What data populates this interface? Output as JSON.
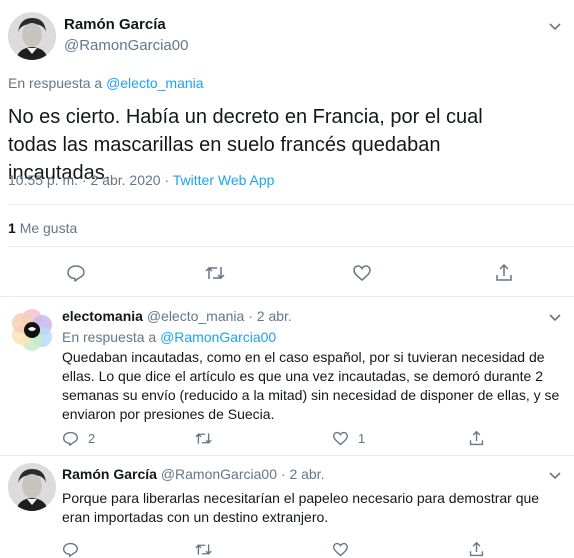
{
  "main_tweet": {
    "author_name": "Ramón García",
    "author_handle": "@RamonGarcia00",
    "reply_prefix": "En respuesta a",
    "reply_to": "@electo_mania",
    "text": "No es cierto. Había un decreto en Francia, por el cual todas las mascarillas en suelo francés quedaban incautadas.",
    "time": "10:55 p. m.",
    "date": "2 abr. 2020",
    "source": "Twitter Web App",
    "likes_count": "1",
    "likes_label": "Me gusta"
  },
  "replies": [
    {
      "author_name": "electomania",
      "author_handle": "@electo_mania",
      "date": "2 abr.",
      "reply_prefix": "En respuesta a",
      "reply_to": "@RamonGarcia00",
      "text": "Quedaban incautadas, como en el caso español, por si tuvieran necesidad de ellas. Lo que dice el artículo es que una vez incautadas, se demoró durante 2 semanas su envío (reducido a la mitad) sin necesidad de disponer de ellas, y se enviaron por presiones de Suecia.",
      "reply_count": "2",
      "like_count": "1"
    },
    {
      "author_name": "Ramón García",
      "author_handle": "@RamonGarcia00",
      "date": "2 abr.",
      "text": "Porque para liberarlas necesitarían el papeleo necesario para demostrar que eran importadas con un destino extranjero."
    }
  ],
  "separator": "·",
  "colors": {
    "link": "#1da1f2",
    "secondary": "#657786",
    "divider": "#e6ecf0"
  },
  "icons": [
    "chevron-down-icon",
    "reply-icon",
    "retweet-icon",
    "like-icon",
    "share-icon"
  ]
}
